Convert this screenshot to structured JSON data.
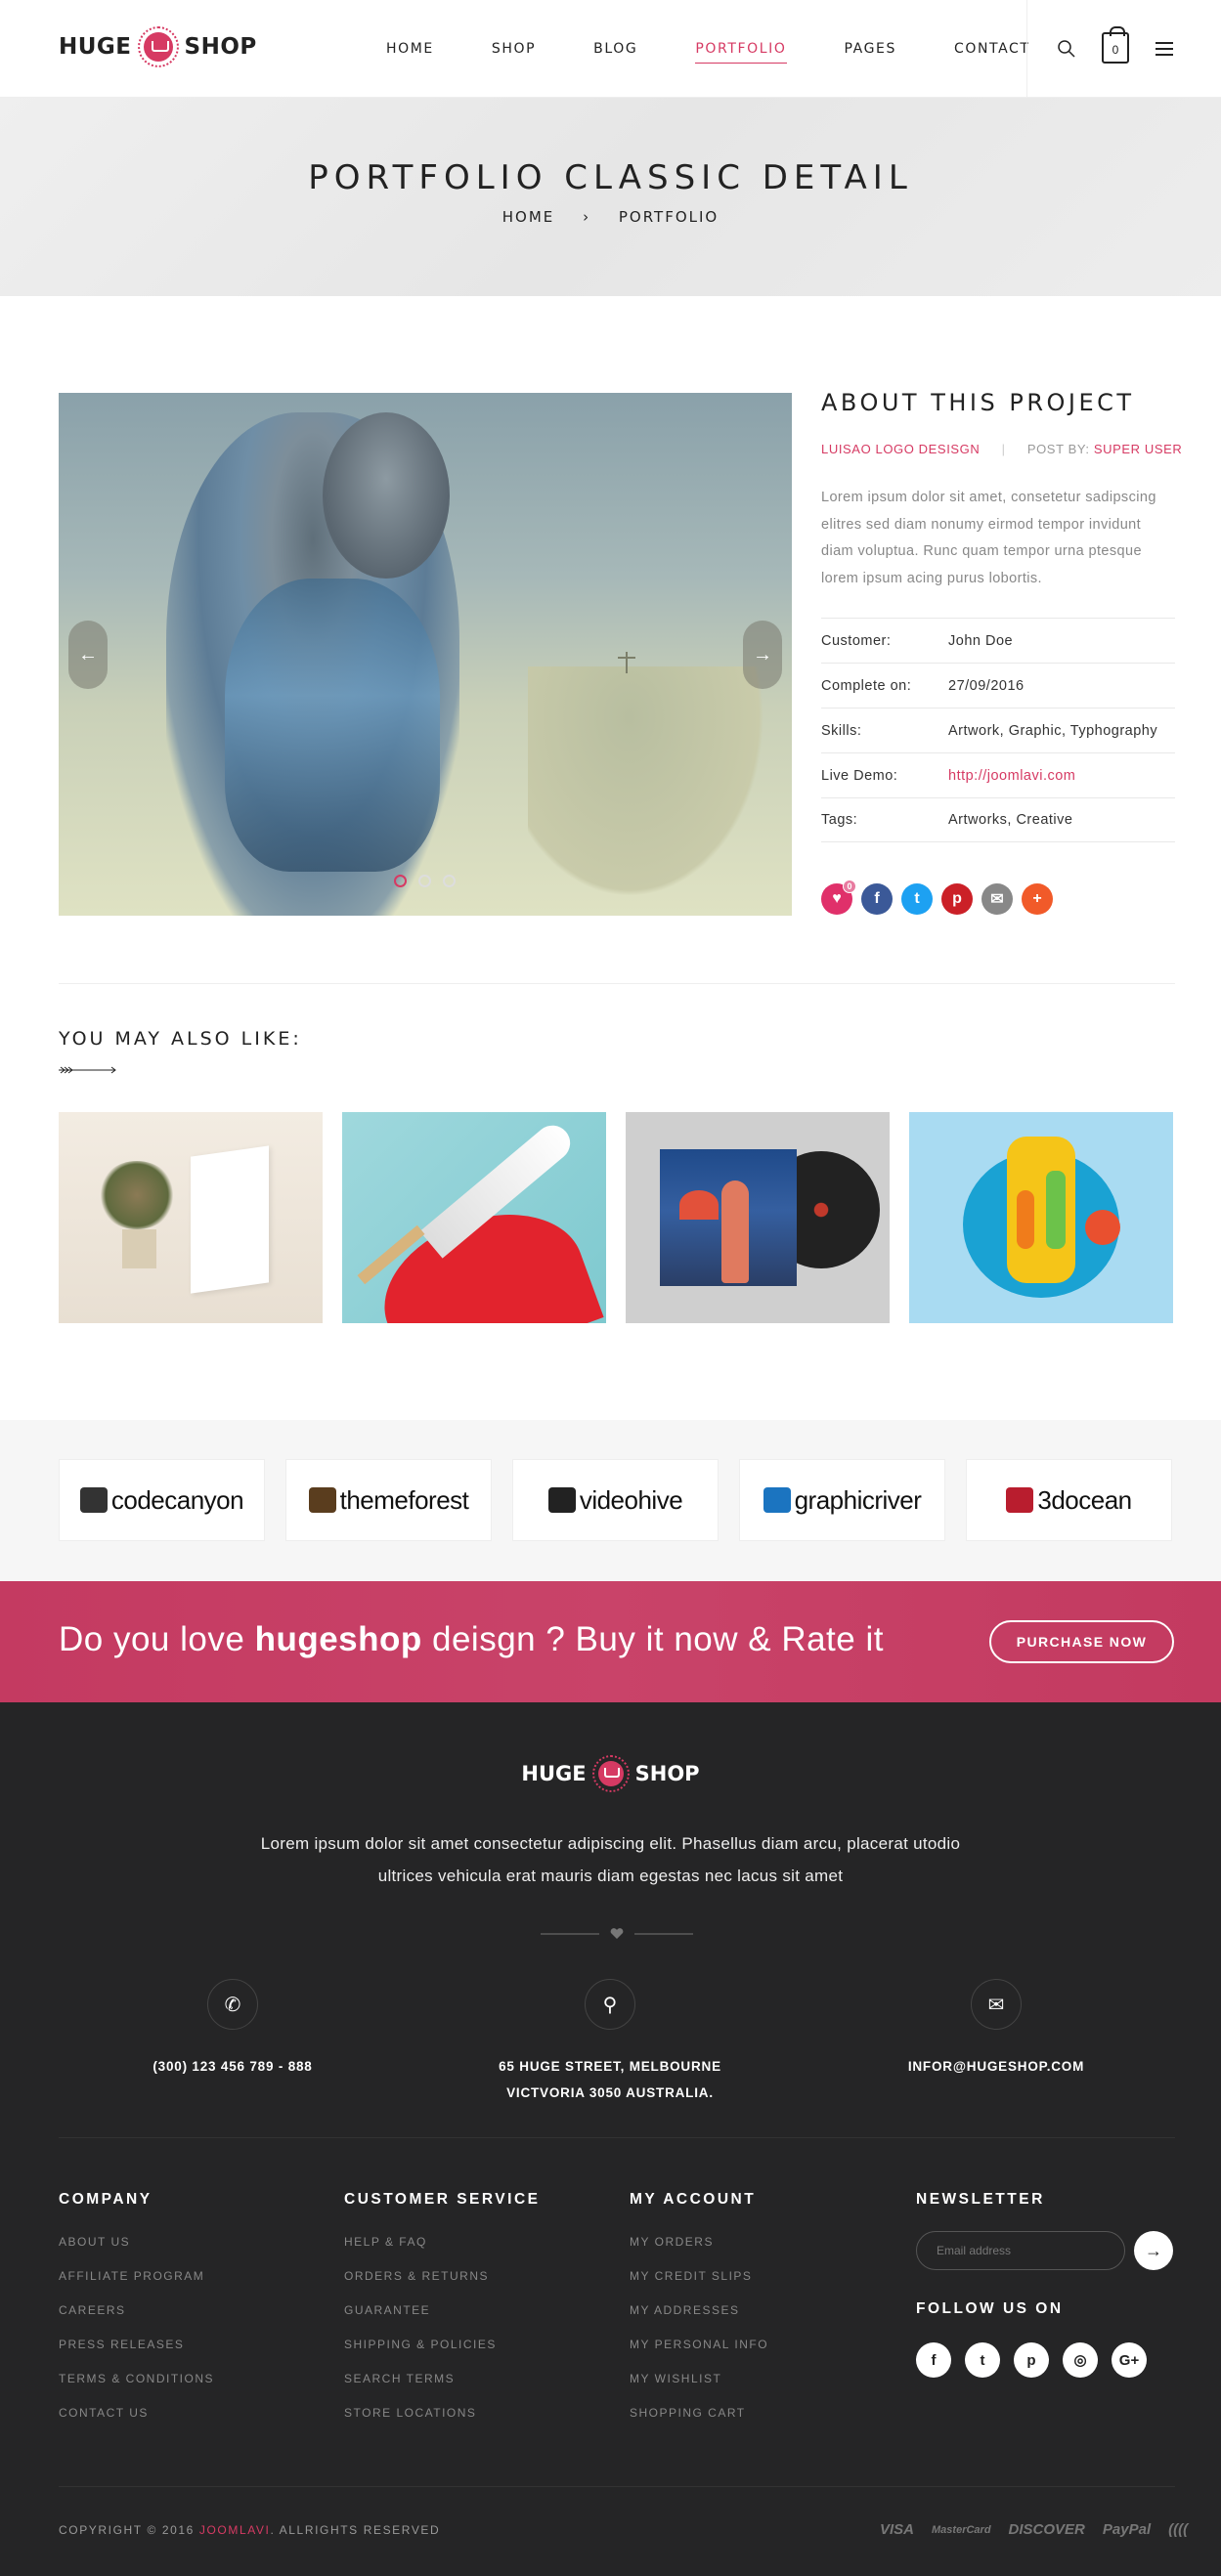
{
  "header": {
    "logo_left": "HUGE",
    "logo_right": "SHOP",
    "nav": [
      {
        "label": "HOME"
      },
      {
        "label": "SHOP"
      },
      {
        "label": "BLOG"
      },
      {
        "label": "PORTFOLIO",
        "active": true
      },
      {
        "label": "PAGES"
      },
      {
        "label": "CONTACT"
      }
    ],
    "cart_count": "0"
  },
  "hero": {
    "title": "PORTFOLIO CLASSIC DETAIL",
    "breadcrumb": [
      "HOME",
      "PORTFOLIO"
    ],
    "breadcrumb_sep": "›"
  },
  "slider": {
    "prev_label": "←",
    "next_label": "→",
    "dot_count": 3,
    "active_dot": 0
  },
  "about": {
    "title": "ABOUT THIS PROJECT",
    "category": "LUISAO LOGO DESISGN",
    "post_by_label": "POST BY:",
    "author": "SUPER USER",
    "description": "Lorem ipsum dolor sit amet, consetetur sadipscing elitres sed diam nonumy eirmod tempor invidunt diam voluptua. Runc quam tempor urna ptesque lorem ipsum acing purus lobortis.",
    "details": [
      {
        "key": "Customer:",
        "value": "John Doe"
      },
      {
        "key": "Complete on:",
        "value": "27/09/2016"
      },
      {
        "key": "Skills:",
        "value": "Artwork, Graphic, Typhography"
      },
      {
        "key": "Live Demo:",
        "value": "http://joomlavi.com",
        "link": true
      },
      {
        "key": "Tags:",
        "value": "Artworks, Creative"
      }
    ],
    "like_count": "0",
    "share_icons": [
      {
        "name": "heart-icon",
        "glyph": "♥",
        "color": "#e0306a"
      },
      {
        "name": "facebook-icon",
        "glyph": "f",
        "color": "#3b5998"
      },
      {
        "name": "twitter-icon",
        "glyph": "t",
        "color": "#1da1f2"
      },
      {
        "name": "pinterest-icon",
        "glyph": "p",
        "color": "#cb2027"
      },
      {
        "name": "email-icon",
        "glyph": "✉",
        "color": "#888888"
      },
      {
        "name": "plus-icon",
        "glyph": "+",
        "color": "#f15a29"
      }
    ]
  },
  "also": {
    "title": "YOU MAY ALSO LIKE:"
  },
  "partners": [
    {
      "name": "codecanyon",
      "color": "#333333"
    },
    {
      "name": "themeforest",
      "color": "#5a3d1e"
    },
    {
      "name": "videohive",
      "color": "#222222"
    },
    {
      "name": "graphicriver",
      "color": "#1b74c0"
    },
    {
      "name": "3docean",
      "color": "#b91d2e"
    }
  ],
  "cta": {
    "text_before": "Do you love ",
    "brand": "hugeshop",
    "text_after": " deisgn ? Buy it now & Rate it",
    "button": "PURCHASE NOW"
  },
  "footer": {
    "logo_left": "HUGE",
    "logo_right": "SHOP",
    "description": "Lorem ipsum dolor sit amet consectetur adipiscing elit. Phasellus diam arcu, placerat utodio ultrices vehicula erat mauris diam egestas nec lacus sit amet",
    "contacts": [
      {
        "icon": "phone-icon",
        "glyph": "✆",
        "text": "(300) 123 456 789 - 888"
      },
      {
        "icon": "location-icon",
        "glyph": "⚲",
        "text": "65 HUGE STREET, MELBOURNE VICTVORIA 3050 AUSTRALIA."
      },
      {
        "icon": "envelope-icon",
        "glyph": "✉",
        "text": "INFOR@HUGESHOP.COM"
      }
    ],
    "columns": [
      {
        "title": "COMPANY",
        "links": [
          "ABOUT US",
          "AFFILIATE PROGRAM",
          "CAREERS",
          "PRESS RELEASES",
          "TERMS & CONDITIONS",
          "CONTACT US"
        ]
      },
      {
        "title": "CUSTOMER SERVICE",
        "links": [
          "HELP & FAQ",
          "ORDERS & RETURNS",
          "GUARANTEE",
          "SHIPPING & POLICIES",
          "SEARCH TERMS",
          "STORE LOCATIONS"
        ]
      },
      {
        "title": "MY ACCOUNT",
        "links": [
          "MY ORDERS",
          "MY CREDIT SLIPS",
          "MY ADDRESSES",
          "MY PERSONAL INFO",
          "MY WISHLIST",
          "SHOPPING CART"
        ]
      }
    ],
    "newsletter": {
      "title": "NEWSLETTER",
      "placeholder": "Email address",
      "submit": "→"
    },
    "follow_title": "FOLLOW US ON",
    "follow": [
      {
        "name": "facebook-icon",
        "glyph": "f"
      },
      {
        "name": "twitter-icon",
        "glyph": "t"
      },
      {
        "name": "pinterest-icon",
        "glyph": "p"
      },
      {
        "name": "instagram-icon",
        "glyph": "◎"
      },
      {
        "name": "google-plus-icon",
        "glyph": "G+"
      }
    ],
    "copyright_before": "COPYRIGHT © 2016 ",
    "copyright_brand": "JOOMLAVI",
    "copyright_after": ". ALLRIGHTS RESERVED",
    "payments": [
      "VISA",
      "MasterCard",
      "DISCOVER",
      "PayPal",
      "(((( "
    ]
  },
  "colors": {
    "accent": "#d63a63",
    "footer_bg": "#252526",
    "cta_bg": "#c94369"
  }
}
